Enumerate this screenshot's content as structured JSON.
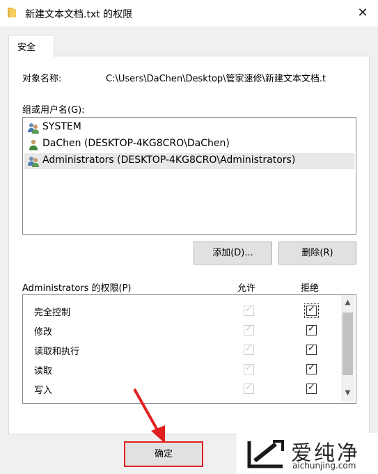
{
  "window": {
    "title": "新建文本文档.txt 的权限",
    "close_glyph": "✕"
  },
  "tabs": [
    {
      "label": "安全",
      "active": true
    }
  ],
  "object": {
    "label": "对象名称:",
    "value": "C:\\Users\\DaChen\\Desktop\\管家速修\\新建文本文档.t"
  },
  "groups": {
    "label": "组或用户名(G):",
    "items": [
      {
        "name": "SYSTEM",
        "icon": "users-group-icon",
        "selected": false
      },
      {
        "name": "DaChen (DESKTOP-4KG8CRO\\DaChen)",
        "icon": "user-icon",
        "selected": false
      },
      {
        "name": "Administrators (DESKTOP-4KG8CRO\\Administrators)",
        "icon": "users-group-icon",
        "selected": true
      }
    ]
  },
  "buttons": {
    "add": "添加(D)...",
    "remove": "删除(R)",
    "ok": "确定"
  },
  "permissions": {
    "label": "Administrators 的权限(P)",
    "allow_header": "允许",
    "deny_header": "拒绝",
    "rows": [
      {
        "name": "完全控制",
        "allow": true,
        "allow_enabled": false,
        "deny": true,
        "deny_enabled": true,
        "focused": true
      },
      {
        "name": "修改",
        "allow": true,
        "allow_enabled": false,
        "deny": true,
        "deny_enabled": true,
        "focused": false
      },
      {
        "name": "读取和执行",
        "allow": true,
        "allow_enabled": false,
        "deny": true,
        "deny_enabled": true,
        "focused": false
      },
      {
        "name": "读取",
        "allow": true,
        "allow_enabled": false,
        "deny": true,
        "deny_enabled": true,
        "focused": false
      },
      {
        "name": "写入",
        "allow": true,
        "allow_enabled": false,
        "deny": true,
        "deny_enabled": true,
        "focused": false
      }
    ]
  },
  "watermark": {
    "name": "爱纯净",
    "url": "aichunjing.com"
  },
  "colors": {
    "highlight_box": "#e02020",
    "arrow": "#e02020"
  }
}
